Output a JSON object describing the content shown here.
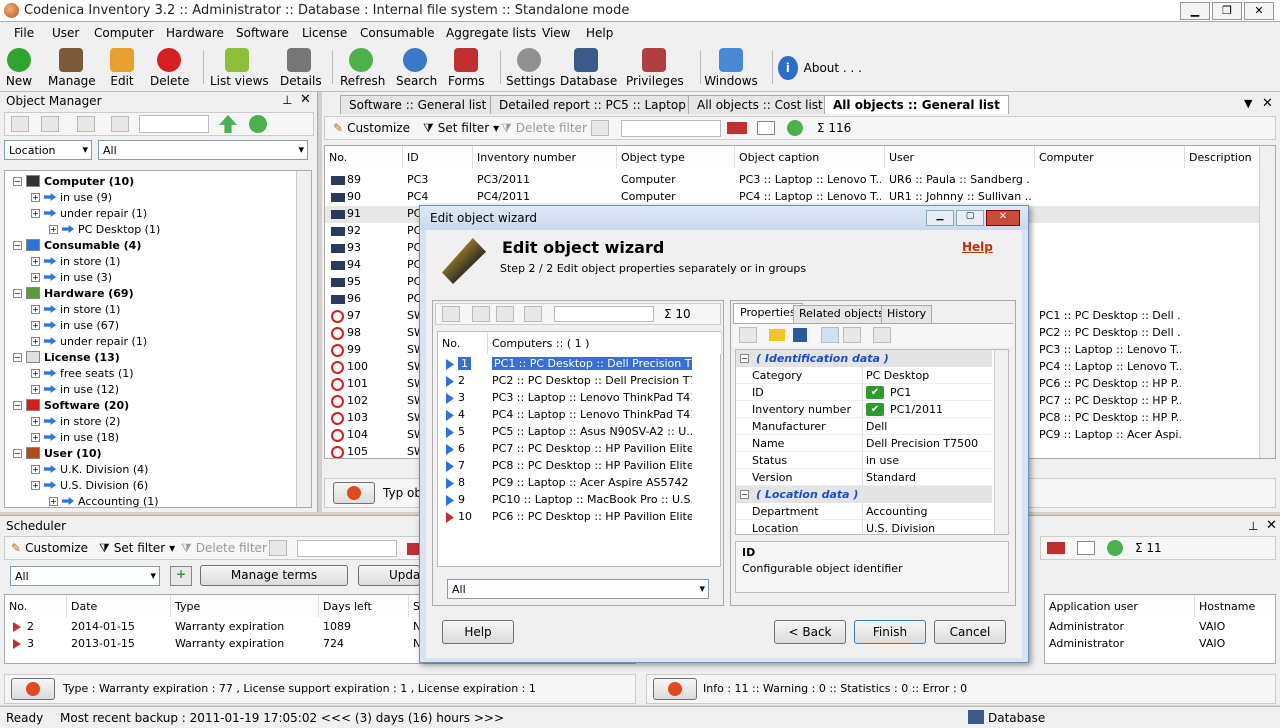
{
  "window": {
    "title": "Codenica Inventory 3.2  ::  Administrator  ::  Database : Internal file system  ::  Standalone mode"
  },
  "menu": [
    "File",
    "User",
    "Computer",
    "Hardware",
    "Software",
    "License",
    "Consumable",
    "Aggregate lists",
    "View",
    "Help"
  ],
  "toolbar": {
    "new": "New",
    "manage": "Manage",
    "edit": "Edit",
    "delete": "Delete",
    "list_views": "List views",
    "details": "Details",
    "refresh": "Refresh",
    "search": "Search",
    "forms": "Forms",
    "settings": "Settings",
    "database": "Database",
    "privileges": "Privileges",
    "windows": "Windows",
    "about": "About . . ."
  },
  "object_manager": {
    "title": "Object Manager",
    "filter_field": "Location",
    "filter_value": "All",
    "tree": [
      {
        "label": "Computer (10)",
        "bold": true,
        "level": 0
      },
      {
        "label": "in use (9)",
        "level": 1
      },
      {
        "label": "under repair (1)",
        "level": 1
      },
      {
        "label": "PC Desktop (1)",
        "level": 2
      },
      {
        "label": "Consumable (4)",
        "bold": true,
        "level": 0
      },
      {
        "label": "in store (1)",
        "level": 1
      },
      {
        "label": "in use (3)",
        "level": 1
      },
      {
        "label": "Hardware (69)",
        "bold": true,
        "level": 0
      },
      {
        "label": "in store (1)",
        "level": 1
      },
      {
        "label": "in use (67)",
        "level": 1
      },
      {
        "label": "under repair (1)",
        "level": 1
      },
      {
        "label": "License (13)",
        "bold": true,
        "level": 0
      },
      {
        "label": "free seats (1)",
        "level": 1
      },
      {
        "label": "in use (12)",
        "level": 1
      },
      {
        "label": "Software (20)",
        "bold": true,
        "level": 0
      },
      {
        "label": "in store (2)",
        "level": 1
      },
      {
        "label": "in use (18)",
        "level": 1
      },
      {
        "label": "User (10)",
        "bold": true,
        "level": 0
      },
      {
        "label": "U.K. Division (4)",
        "level": 1
      },
      {
        "label": "U.S. Division (6)",
        "level": 1
      },
      {
        "label": "Accounting (1)",
        "level": 2
      }
    ]
  },
  "tabs": [
    "Software  ::  General list",
    "Detailed report  ::  PC5 :: Laptop ::...",
    "All objects  ::  Cost list",
    "All objects  ::  General list"
  ],
  "list_toolbar": {
    "customize": "Customize",
    "set_filter": "Set filter",
    "delete_filter": "Delete filter",
    "count": "Σ  116"
  },
  "grid": {
    "headers": [
      "No.",
      "ID",
      "Inventory number",
      "Object type",
      "Object caption",
      "User",
      "Computer",
      "Description"
    ],
    "rows": [
      {
        "no": "89",
        "id": "PC3",
        "inv": "PC3/2011",
        "type": "Computer",
        "caption": "PC3 :: Laptop :: Lenovo T...",
        "user": "UR6 :: Paula :: Sandberg ...",
        "computer": ""
      },
      {
        "no": "90",
        "id": "PC4",
        "inv": "PC4/2011",
        "type": "Computer",
        "caption": "PC4 :: Laptop :: Lenovo T...",
        "user": "UR1 :: Johnny :: Sullivan ...",
        "computer": ""
      },
      {
        "no": "91",
        "id": "PC",
        "inv": "",
        "type": "",
        "caption": "",
        "user": "",
        "computer": ""
      },
      {
        "no": "92",
        "id": "PC",
        "inv": "",
        "type": "",
        "caption": "",
        "user": "",
        "computer": ""
      },
      {
        "no": "93",
        "id": "PC",
        "inv": "",
        "type": "",
        "caption": "",
        "user": "",
        "computer": ""
      },
      {
        "no": "94",
        "id": "PC",
        "inv": "",
        "type": "",
        "caption": "",
        "user": "",
        "computer": ""
      },
      {
        "no": "95",
        "id": "PC",
        "inv": "",
        "type": "",
        "caption": "",
        "user": "",
        "computer": ""
      },
      {
        "no": "96",
        "id": "PC",
        "inv": "",
        "type": "",
        "caption": "",
        "user": "",
        "computer": ""
      },
      {
        "no": "97",
        "id": "SW",
        "inv": "",
        "type": "",
        "caption": "",
        "user": "",
        "computer": "PC1 :: PC Desktop :: Dell ..."
      },
      {
        "no": "98",
        "id": "SW",
        "inv": "",
        "type": "",
        "caption": "",
        "user": "",
        "computer": "PC2 :: PC Desktop :: Dell ..."
      },
      {
        "no": "99",
        "id": "SW",
        "inv": "",
        "type": "",
        "caption": "",
        "user": "",
        "computer": "PC3 :: Laptop :: Lenovo T..."
      },
      {
        "no": "100",
        "id": "SW",
        "inv": "",
        "type": "",
        "caption": "",
        "user": "",
        "computer": "PC4 :: Laptop :: Lenovo T..."
      },
      {
        "no": "101",
        "id": "SW",
        "inv": "",
        "type": "",
        "caption": "",
        "user": "",
        "computer": "PC6 :: PC Desktop :: HP P..."
      },
      {
        "no": "102",
        "id": "SW",
        "inv": "",
        "type": "",
        "caption": "",
        "user": "",
        "computer": "PC7 :: PC Desktop :: HP P..."
      },
      {
        "no": "103",
        "id": "SW",
        "inv": "",
        "type": "",
        "caption": "",
        "user": "",
        "computer": "PC8 :: PC Desktop :: HP P..."
      },
      {
        "no": "104",
        "id": "SW",
        "inv": "",
        "type": "",
        "caption": "",
        "user": "",
        "computer": "PC9 :: Laptop :: Acer Aspi..."
      },
      {
        "no": "105",
        "id": "SW",
        "inv": "",
        "type": "",
        "caption": "",
        "user": "",
        "computer": ""
      }
    ],
    "footer_label": "Typ obj"
  },
  "scheduler": {
    "title": "Scheduler",
    "customize": "Customize",
    "set_filter": "Set filter",
    "delete_filter": "Delete filter",
    "filter_value": "All",
    "manage_terms": "Manage terms",
    "update": "Update",
    "headers": [
      "No.",
      "Date",
      "Type",
      "Days left",
      "S"
    ],
    "rows": [
      {
        "no": "2",
        "date": "2014-01-15",
        "type": "Warranty expiration",
        "days": "1089",
        "s": "N"
      },
      {
        "no": "3",
        "date": "2013-01-15",
        "type": "Warranty expiration",
        "days": "724",
        "s": "N"
      }
    ],
    "summary": "Type : Warranty expiration : 77 , License support expiration : 1 , License expiration : 1"
  },
  "log": {
    "count": "Σ  11",
    "headers": [
      "Application user",
      "Hostname"
    ],
    "rows": [
      {
        "user": "Administrator",
        "host": "VAIO"
      },
      {
        "user": "Administrator",
        "host": "VAIO"
      }
    ],
    "summary": "Info : 11   ::  Warning : 0   ::  Statistics : 0   ::  Error : 0"
  },
  "dialog": {
    "title": "Edit object wizard",
    "heading": "Edit object wizard",
    "help_link": "Help",
    "step": "Step 2 / 2   Edit object properties separately or in groups",
    "left_count": "Σ  10",
    "list_header_no": "No.",
    "list_header": "Computers  ::  ( 1 )",
    "items": [
      {
        "no": "1",
        "label": "PC1 :: PC Desktop :: Dell Precision T7..."
      },
      {
        "no": "2",
        "label": "PC2 :: PC Desktop :: Dell Precision T7..."
      },
      {
        "no": "3",
        "label": "PC3 :: Laptop :: Lenovo ThinkPad T41..."
      },
      {
        "no": "4",
        "label": "PC4 :: Laptop :: Lenovo ThinkPad T41..."
      },
      {
        "no": "5",
        "label": "PC5 :: Laptop :: Asus N90SV-A2 :: U...."
      },
      {
        "no": "6",
        "label": "PC7 :: PC Desktop :: HP Pavilion Elite ..."
      },
      {
        "no": "7",
        "label": "PC8 :: PC Desktop :: HP Pavilion Elite ..."
      },
      {
        "no": "8",
        "label": "PC9 :: Laptop :: Acer Aspire AS5742 ::..."
      },
      {
        "no": "9",
        "label": "PC10 :: Laptop :: MacBook Pro :: U.S...."
      },
      {
        "no": "10",
        "label": "PC6 :: PC Desktop :: HP Pavilion Elite ..."
      }
    ],
    "list_filter": "All",
    "tabs": [
      "Properties",
      "Related objects",
      "History"
    ],
    "group1": "( Identification data )",
    "group2": "( Location data )",
    "props": [
      {
        "k": "Category",
        "v": "PC Desktop"
      },
      {
        "k": "ID",
        "v": "PC1",
        "check": true
      },
      {
        "k": "Inventory number",
        "v": "PC1/2011",
        "check": true
      },
      {
        "k": "Manufacturer",
        "v": "Dell"
      },
      {
        "k": "Name",
        "v": "Dell Precision T7500"
      },
      {
        "k": "Status",
        "v": "in use"
      },
      {
        "k": "Version",
        "v": "Standard"
      }
    ],
    "props2": [
      {
        "k": "Department",
        "v": "Accounting"
      },
      {
        "k": "Location",
        "v": "U.S. Division"
      }
    ],
    "desc_title": "ID",
    "desc_text": "Configurable object identifier",
    "buttons": {
      "help": "Help",
      "back": "< Back",
      "finish": "Finish",
      "cancel": "Cancel"
    }
  },
  "statusbar": {
    "ready": "Ready",
    "backup": "Most recent backup : 2011-01-19 17:05:02  <<< (3) days (16) hours >>>",
    "db": "Database"
  }
}
